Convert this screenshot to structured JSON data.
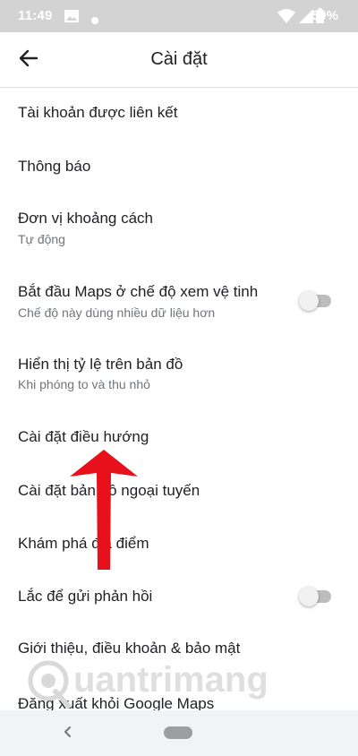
{
  "status_bar": {
    "time": "11:49",
    "battery": "50%",
    "icons": [
      "image-icon",
      "dot-icon",
      "wifi-icon",
      "signal-icon",
      "battery-icon"
    ]
  },
  "app_bar": {
    "title": "Cài đặt",
    "back_icon": "arrow-left-icon"
  },
  "settings": [
    {
      "title": "Tài khoản được liên kết"
    },
    {
      "title": "Thông báo"
    },
    {
      "title": "Đơn vị khoảng cách",
      "subtitle": "Tự động"
    },
    {
      "title": "Bắt đầu Maps ở chế độ xem vệ tinh",
      "subtitle": "Chế độ này dùng nhiều dữ liệu hơn",
      "toggle": false
    },
    {
      "title": "Hiển thị tỷ lệ trên bản đồ",
      "subtitle": "Khi phóng to và thu nhỏ"
    },
    {
      "title": "Cài đặt điều hướng"
    },
    {
      "title": "Cài đặt bản đồ ngoại tuyến"
    },
    {
      "title": "Khám phá địa điểm"
    },
    {
      "title": "Lắc để gửi phản hồi",
      "toggle": false
    },
    {
      "title": "Giới thiệu, điều khoản & bảo mật"
    },
    {
      "title": "Đăng xuất khỏi Google Maps"
    }
  ],
  "annotation": {
    "arrow_color": "#e8101b",
    "watermark": "uantrimang",
    "watermark_color": "#d9d9d9"
  },
  "nav_bar": {
    "back_icon": "chevron-left-icon",
    "home_icon": "home-pill-icon"
  }
}
